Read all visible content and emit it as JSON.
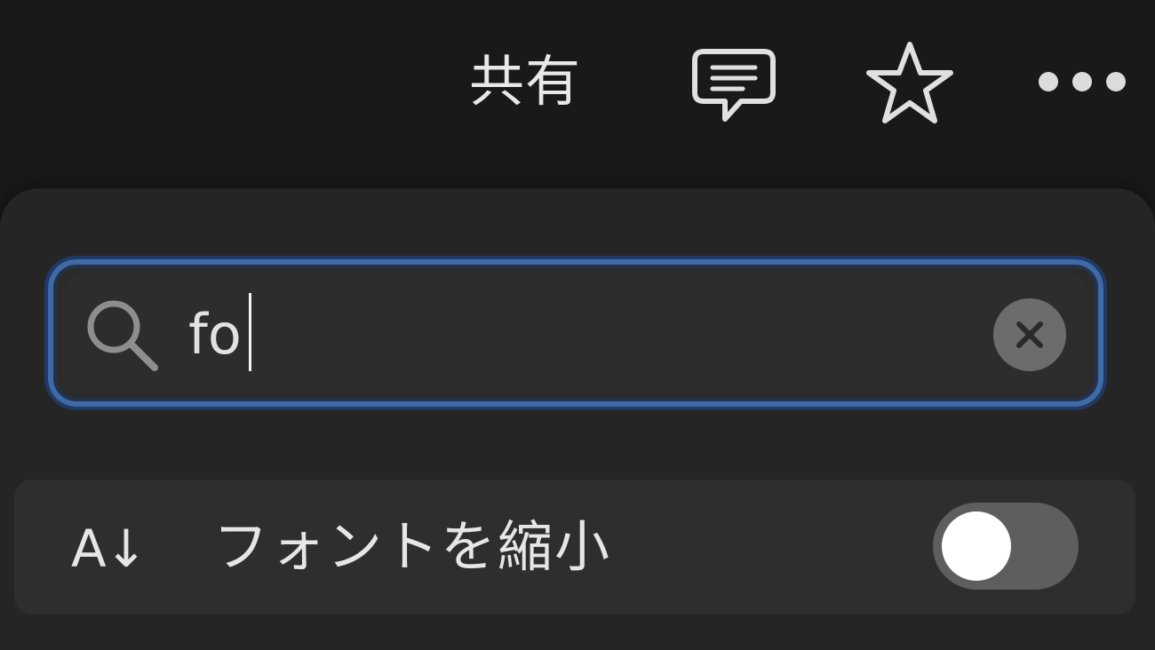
{
  "topbar": {
    "share_label": "共有",
    "icons": [
      "comment-icon",
      "star-icon",
      "more-icon"
    ]
  },
  "search": {
    "value": "fo",
    "placeholder": ""
  },
  "option": {
    "icon_text": "A↓",
    "label": "フォントを縮小",
    "toggle_on": false
  },
  "colors": {
    "background": "#191919",
    "panel": "#252525",
    "focus_ring": "#3e6aa8",
    "toggle_off": "#5e5e5e"
  }
}
